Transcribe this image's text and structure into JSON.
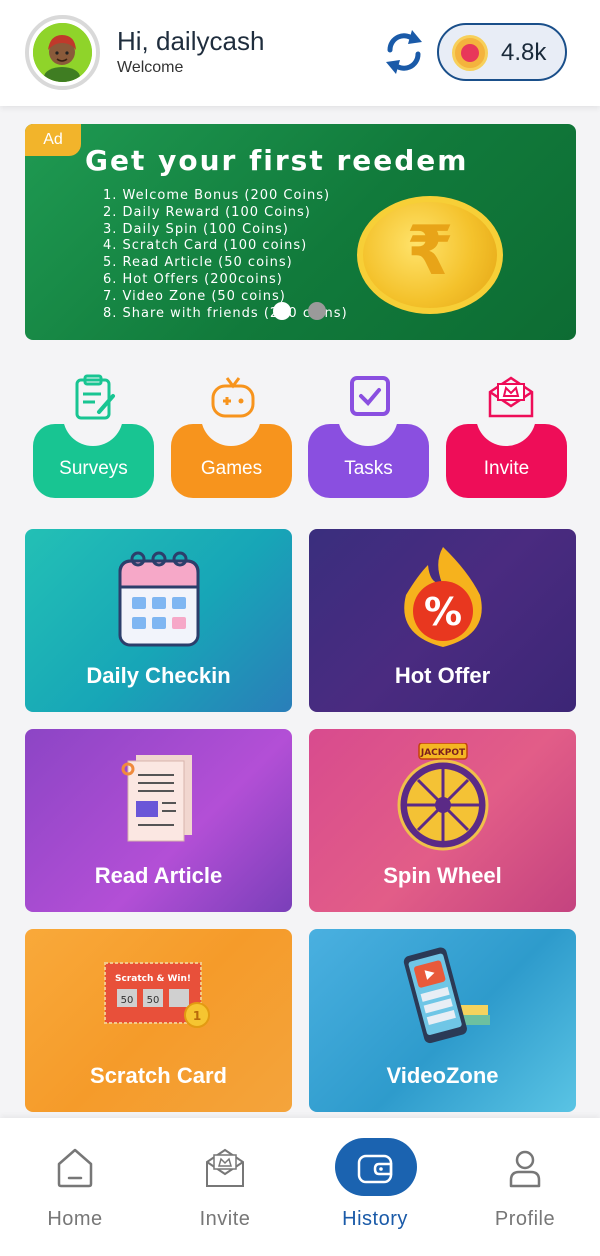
{
  "header": {
    "greeting_prefix": "Hi,",
    "username": "dailycash",
    "subtitle": "Welcome",
    "coins": "4.8k",
    "icons": {
      "avatar": "user-avatar",
      "refresh": "refresh-icon",
      "coin": "coin-star-icon"
    }
  },
  "banner": {
    "ad_tag": "Ad",
    "title": "Get your first reedem",
    "items": [
      "1. Welcome Bonus (200 Coins)",
      "2. Daily Reward  (100 Coins)",
      "3. Daily Spin (100 Coins)",
      "4. Scratch Card (100 coins)",
      "5. Read Article (50 coins)",
      "6. Hot Offers (200coins)",
      "7. Video Zone (50 coins)",
      "8. Share with friends (200 coins)"
    ],
    "coin_symbol": "₹"
  },
  "categories": [
    {
      "label": "Surveys",
      "icon": "clipboard-icon",
      "color": "#18c592"
    },
    {
      "label": "Games",
      "icon": "gamepad-icon",
      "color": "#f7941d"
    },
    {
      "label": "Tasks",
      "icon": "checkbox-icon",
      "color": "#8a4fe0"
    },
    {
      "label": "Invite",
      "icon": "envelope-icon",
      "color": "#ee0d58"
    }
  ],
  "cards": [
    {
      "label": "Daily Checkin",
      "icon": "calendar-icon"
    },
    {
      "label": "Hot Offer",
      "icon": "percent-flame-icon"
    },
    {
      "label": "Read Article",
      "icon": "article-icon"
    },
    {
      "label": "Spin Wheel",
      "icon": "wheel-icon",
      "badge": "JACKPOT"
    },
    {
      "label": "Scratch Card",
      "icon": "scratch-card-icon",
      "card_title": "Scratch & Win!",
      "card_values": [
        "50",
        "50"
      ],
      "coin_value": "1"
    },
    {
      "label": "VideoZone",
      "icon": "video-phone-icon"
    }
  ],
  "bottom_nav": [
    {
      "label": "Home",
      "icon": "home-icon",
      "active": false
    },
    {
      "label": "Invite",
      "icon": "invite-icon",
      "active": false
    },
    {
      "label": "History",
      "icon": "wallet-icon",
      "active": true
    },
    {
      "label": "Profile",
      "icon": "profile-icon",
      "active": false
    }
  ],
  "colors": {
    "accent": "#1b63b0",
    "nav_inactive": "#777777"
  }
}
